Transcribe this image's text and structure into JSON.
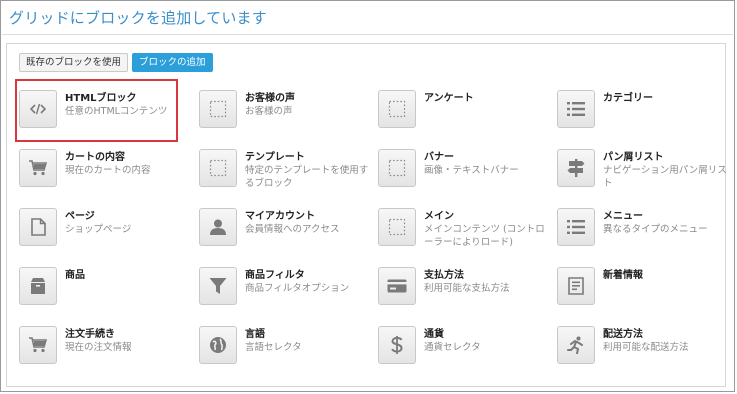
{
  "header": {
    "title": "グリッドにブロックを追加しています"
  },
  "tabs": [
    {
      "label": "既存のブロックを使用"
    },
    {
      "label": "ブロックの追加"
    }
  ],
  "blocks": [
    {
      "name": "HTMLブロック",
      "desc": "任意のHTMLコンテンツ",
      "icon": "code-icon"
    },
    {
      "name": "お客様の声",
      "desc": "お客様の声",
      "icon": "dotted-square-icon"
    },
    {
      "name": "アンケート",
      "desc": "",
      "icon": "dotted-square-icon"
    },
    {
      "name": "カテゴリー",
      "desc": "",
      "icon": "list-icon"
    },
    {
      "name": "カートの内容",
      "desc": "現在のカートの内容",
      "icon": "cart-icon"
    },
    {
      "name": "テンプレート",
      "desc": "特定のテンプレートを使用するブロック",
      "icon": "dotted-square-icon"
    },
    {
      "name": "バナー",
      "desc": "画像・テキストバナー",
      "icon": "dotted-square-icon"
    },
    {
      "name": "パン屑リスト",
      "desc": "ナビゲーション用パン屑リスト",
      "icon": "signpost-icon"
    },
    {
      "name": "ページ",
      "desc": "ショップページ",
      "icon": "page-icon"
    },
    {
      "name": "マイアカウント",
      "desc": "会員情報へのアクセス",
      "icon": "user-icon"
    },
    {
      "name": "メイン",
      "desc": "メインコンテンツ (コントローラーによりロード)",
      "icon": "dotted-square-icon"
    },
    {
      "name": "メニュー",
      "desc": "異なるタイプのメニュー",
      "icon": "list-icon"
    },
    {
      "name": "商品",
      "desc": "",
      "icon": "box-icon"
    },
    {
      "name": "商品フィルタ",
      "desc": "商品フィルタオプション",
      "icon": "filter-icon"
    },
    {
      "name": "支払方法",
      "desc": "利用可能な支払方法",
      "icon": "card-icon"
    },
    {
      "name": "新着情報",
      "desc": "",
      "icon": "news-icon"
    },
    {
      "name": "注文手続き",
      "desc": "現在の注文情報",
      "icon": "cart-icon"
    },
    {
      "name": "言語",
      "desc": "言語セレクタ",
      "icon": "globe-icon"
    },
    {
      "name": "通貨",
      "desc": "通貨セレクタ",
      "icon": "dollar-icon"
    },
    {
      "name": "配送方法",
      "desc": "利用可能な配送方法",
      "icon": "runner-icon"
    }
  ]
}
